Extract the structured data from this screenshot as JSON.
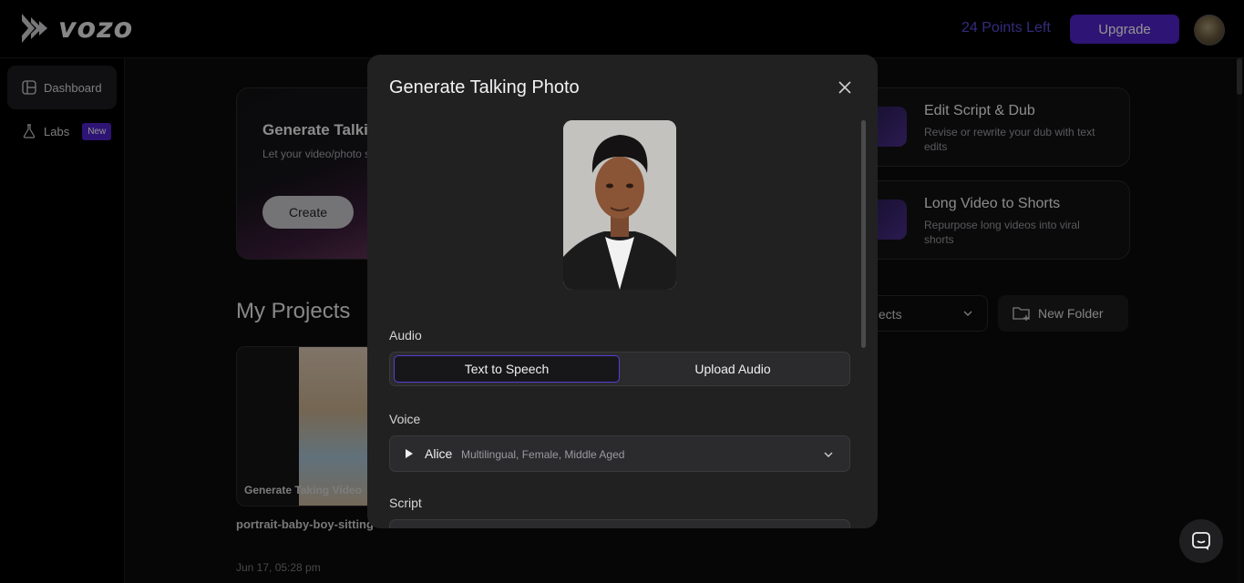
{
  "header": {
    "logo_text": "vozo",
    "points_left": "24 Points Left",
    "upgrade_label": "Upgrade"
  },
  "sidebar": {
    "items": [
      {
        "label": "Dashboard",
        "icon": "layout-icon",
        "active": true
      },
      {
        "label": "Labs",
        "icon": "flask-icon",
        "badge": "New"
      }
    ]
  },
  "background": {
    "generate_card": {
      "title": "Generate Talkin",
      "description": "Let your video/photo sync",
      "create_label": "Create"
    },
    "features": [
      {
        "title": "Edit Script & Dub",
        "description": "Revise or rewrite your dub with text edits",
        "icon": "waveform-icon"
      },
      {
        "title": "Long Video to Shorts",
        "description": "Repurpose long videos into viral shorts",
        "icon": "film-icon"
      }
    ],
    "projects": {
      "title": "My Projects",
      "filter_label": "ojects",
      "new_folder_label": "New Folder",
      "items": [
        {
          "tag": "Generate Taking Video",
          "name": "portrait-baby-boy-sitting",
          "date": "Jun 17, 05:28 pm"
        }
      ]
    }
  },
  "modal": {
    "title": "Generate Talking Photo",
    "audio_label": "Audio",
    "audio_options": [
      "Text to Speech",
      "Upload Audio"
    ],
    "audio_selected": "Text to Speech",
    "voice_label": "Voice",
    "voice": {
      "name": "Alice",
      "description": "Multilingual, Female, Middle Aged"
    },
    "script_label": "Script"
  },
  "colors": {
    "accent": "#5024c8",
    "points_text": "#5b4ad8",
    "modal_bg": "#212122",
    "page_bg": "#0b0b0c"
  }
}
